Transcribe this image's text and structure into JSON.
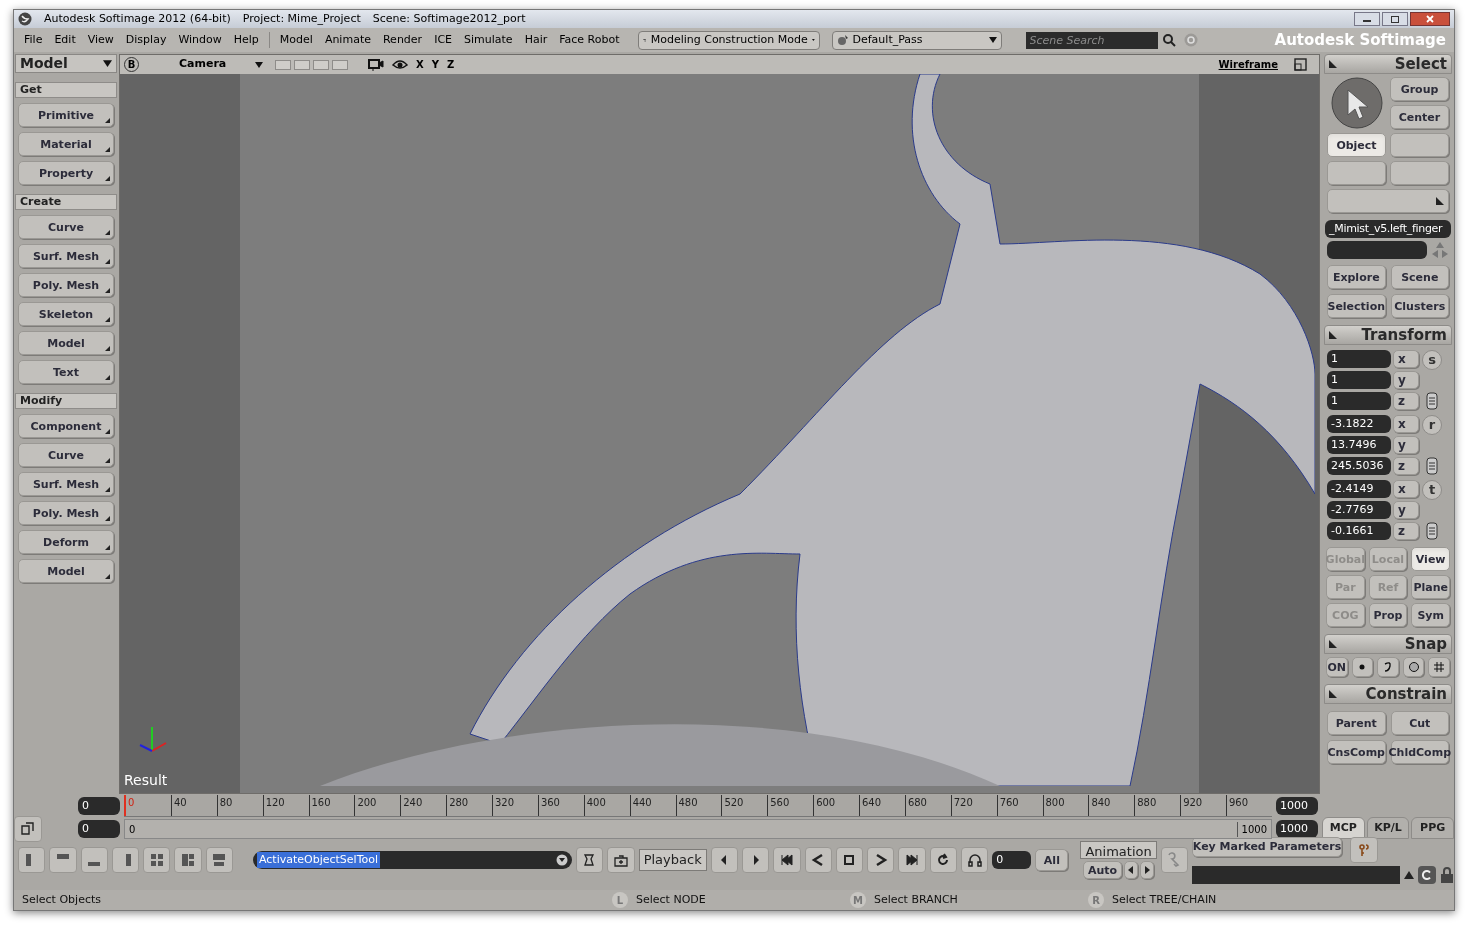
{
  "window": {
    "title": "Autodesk Softimage 2012 (64-bit)",
    "project": "Project: Mime_Project",
    "scene": "Scene: Softimage2012_port"
  },
  "menu": [
    "File",
    "Edit",
    "View",
    "Display",
    "Window",
    "Help",
    "Model",
    "Animate",
    "Render",
    "ICE",
    "Simulate",
    "Hair",
    "Face Robot"
  ],
  "mode_dropdown": "Modeling Construction Mode",
  "pass_dropdown": "Default_Pass",
  "search": {
    "placeholder": "Scene Search"
  },
  "brand": "Autodesk Softimage",
  "left_panel": {
    "mode": "Model",
    "sections": [
      {
        "title": "Get",
        "items": [
          "Primitive",
          "Material",
          "Property"
        ]
      },
      {
        "title": "Create",
        "items": [
          "Curve",
          "Surf. Mesh",
          "Poly. Mesh",
          "Skeleton",
          "Model",
          "Text"
        ]
      },
      {
        "title": "Modify",
        "items": [
          "Component",
          "Curve",
          "Surf. Mesh",
          "Poly. Mesh",
          "Deform",
          "Model"
        ]
      }
    ]
  },
  "viewport": {
    "badge": "B",
    "camera": "Camera",
    "axes": [
      "X",
      "Y",
      "Z"
    ],
    "display_mode": "Wireframe",
    "result_label": "Result"
  },
  "select_panel": {
    "title": "Select",
    "buttons": [
      {
        "label": "Group",
        "selected": false
      },
      {
        "label": "Center",
        "selected": false
      },
      {
        "label": "Object",
        "selected": true
      }
    ],
    "object_name": "_Mimist_v5.left_finger",
    "explore": [
      "Explore",
      "Scene",
      "Selection",
      "Clusters"
    ]
  },
  "transform_panel": {
    "title": "Transform",
    "groups": [
      {
        "symbol": "s",
        "values": [
          "1",
          "1",
          "1"
        ],
        "axes": [
          "x",
          "y",
          "z"
        ]
      },
      {
        "symbol": "r",
        "values": [
          "-3.1822",
          "13.7496",
          "245.5036"
        ],
        "axes": [
          "x",
          "y",
          "z"
        ]
      },
      {
        "symbol": "t",
        "values": [
          "-2.4149",
          "-2.7769",
          "-0.1661"
        ],
        "axes": [
          "x",
          "y",
          "z"
        ]
      }
    ],
    "modes": [
      {
        "label": "Global",
        "selected": false,
        "disabled": true
      },
      {
        "label": "Local",
        "selected": false,
        "disabled": true
      },
      {
        "label": "View",
        "selected": true,
        "disabled": false
      },
      {
        "label": "Par",
        "selected": false,
        "disabled": true
      },
      {
        "label": "Ref",
        "selected": false,
        "disabled": true
      },
      {
        "label": "Plane",
        "selected": false,
        "disabled": false
      },
      {
        "label": "COG",
        "selected": false,
        "disabled": true
      },
      {
        "label": "Prop",
        "selected": false,
        "disabled": false
      },
      {
        "label": "Sym",
        "selected": false,
        "disabled": false
      }
    ]
  },
  "snap_panel": {
    "title": "Snap",
    "on_label": "ON"
  },
  "constrain_panel": {
    "title": "Constrain",
    "buttons": [
      "Parent",
      "Cut",
      "CnsComp",
      "ChldComp"
    ]
  },
  "panel_tabs": [
    {
      "label": "MCP",
      "selected": true
    },
    {
      "label": "KP/L",
      "selected": false
    },
    {
      "label": "PPG",
      "selected": false
    }
  ],
  "timeline": {
    "start": "0",
    "ticks": [
      "0",
      "40",
      "80",
      "120",
      "160",
      "200",
      "240",
      "280",
      "320",
      "360",
      "400",
      "440",
      "480",
      "520",
      "560",
      "600",
      "640",
      "680",
      "720",
      "760",
      "800",
      "840",
      "880",
      "920",
      "960"
    ],
    "end": "1000",
    "range_start": "0",
    "range": {
      "start_label": "0",
      "end_label": "1000",
      "level": 1
    },
    "range_end": "1000"
  },
  "command_field": "ActivateObjectSelTool",
  "playback": {
    "button": "Playback",
    "frame": "0",
    "all": "All"
  },
  "animation": {
    "button": "Animation",
    "auto": "Auto",
    "key_marked": "Key Marked Parameters"
  },
  "status_bar": {
    "message": "Select Objects",
    "mouse": [
      {
        "key": "L",
        "action": "Select NODE"
      },
      {
        "key": "M",
        "action": "Select BRANCH"
      },
      {
        "key": "R",
        "action": "Select TREE/CHAIN"
      }
    ]
  }
}
